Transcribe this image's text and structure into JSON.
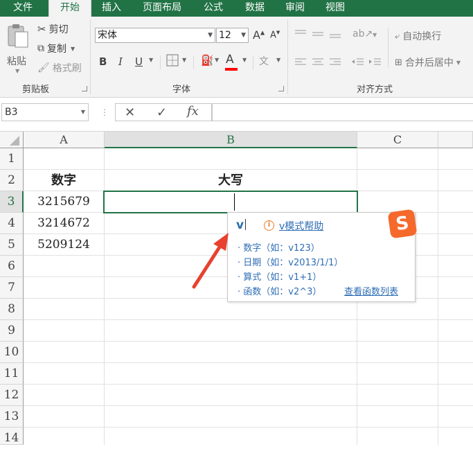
{
  "tabs": [
    {
      "label": "文件",
      "active": false
    },
    {
      "label": "开始",
      "active": true
    },
    {
      "label": "插入",
      "active": false
    },
    {
      "label": "页面布局",
      "active": false
    },
    {
      "label": "公式",
      "active": false
    },
    {
      "label": "数据",
      "active": false
    },
    {
      "label": "审阅",
      "active": false
    },
    {
      "label": "视图",
      "active": false
    }
  ],
  "clipboard": {
    "paste_label": "粘贴",
    "cut_label": "剪切",
    "copy_label": "复制",
    "format_painter_label": "格式刷",
    "group_label": "剪贴板"
  },
  "font": {
    "font_name": "宋体",
    "font_size": "12",
    "grow_label": "A",
    "shrink_label": "A",
    "bold_label": "B",
    "italic_label": "I",
    "underline_label": "U",
    "font_color_label": "A",
    "phonetic_label": "文",
    "group_label": "字体"
  },
  "alignment": {
    "wrap_text_label": "自动换行",
    "merge_center_label": "合并后居中",
    "group_label": "对齐方式"
  },
  "formula_bar": {
    "name_box": "B3",
    "fx_label": "fx",
    "cancel_label": "✕",
    "enter_label": "✓"
  },
  "columns": [
    "A",
    "B",
    "C"
  ],
  "rows": [
    "1",
    "2",
    "3",
    "4",
    "5",
    "6",
    "7",
    "8",
    "9",
    "10",
    "11",
    "12",
    "13",
    "14"
  ],
  "cells": {
    "A2": "数字",
    "B2": "大写",
    "A3": "3215679",
    "A4": "3214672",
    "A5": "5209124"
  },
  "ime_popup": {
    "typed": "v",
    "help_link": "v模式帮助",
    "items": [
      "· 数字（如：v123）",
      "· 日期（如：v2013/1/1）",
      "· 算式（如：v1+1）",
      "· 函数（如：v2^3）"
    ],
    "function_list_link": "查看函数列表",
    "logo_letter": "S"
  },
  "colors": {
    "accent": "#217346",
    "arrow": "#e8412f",
    "link": "#2d6db5"
  }
}
